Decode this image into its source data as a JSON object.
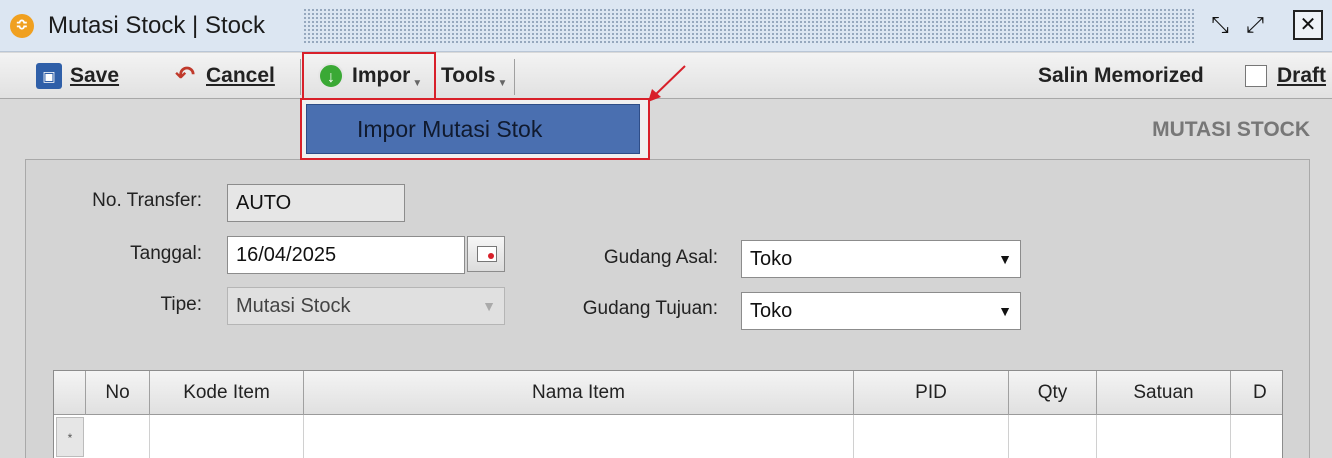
{
  "window": {
    "title": "Mutasi Stock | Stock",
    "app_icon": "app-logo-icon",
    "buttons": {
      "restore": "restore-icon",
      "maximize": "maximize-icon",
      "close": "close-icon"
    }
  },
  "toolbar": {
    "save_label": "Save",
    "cancel_label": "Cancel",
    "impor_label": "Impor",
    "tools_label": "Tools",
    "salin_label": "Salin Memorized",
    "draft_label": "Draft",
    "draft_checked": false
  },
  "menu": {
    "impor_items": [
      "Impor Mutasi Stok"
    ]
  },
  "page": {
    "heading": "MUTASI STOCK"
  },
  "form": {
    "no_transfer_label": "No. Transfer:",
    "no_transfer_value": "AUTO",
    "tanggal_label": "Tanggal:",
    "tanggal_value": "16/04/2025",
    "tipe_label": "Tipe:",
    "tipe_value": "Mutasi Stock",
    "gudang_asal_label": "Gudang Asal:",
    "gudang_asal_value": "Toko",
    "gudang_tujuan_label": "Gudang Tujuan:",
    "gudang_tujuan_value": "Toko"
  },
  "grid": {
    "columns": [
      "No",
      "Kode Item",
      "Nama Item",
      "PID",
      "Qty",
      "Satuan",
      "D"
    ],
    "new_row_marker": "*"
  },
  "colors": {
    "highlight": "#d8202a",
    "menu_selected": "#4a6fb0",
    "titlebar": "#dce6f2"
  }
}
